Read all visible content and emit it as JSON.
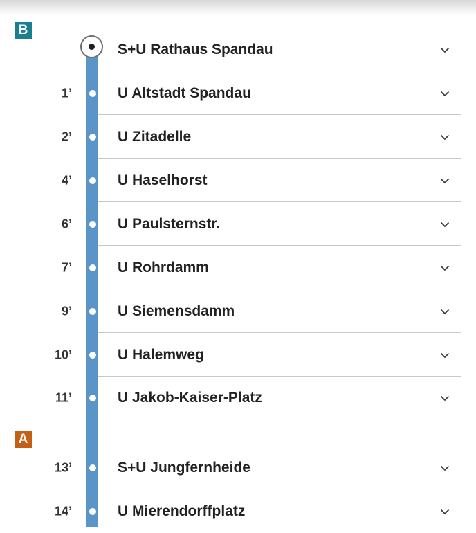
{
  "zones": {
    "b": "B",
    "a": "A"
  },
  "stops": [
    {
      "time": "",
      "name": "S+U Rathaus Spandau",
      "icon": "chevron-down-icon"
    },
    {
      "time": "1’",
      "name": "U Altstadt Spandau",
      "icon": "chevron-down-icon"
    },
    {
      "time": "2’",
      "name": "U Zitadelle",
      "icon": "chevron-down-icon"
    },
    {
      "time": "4’",
      "name": "U Haselhorst",
      "icon": "chevron-down-icon"
    },
    {
      "time": "6’",
      "name": "U Paulsternstr.",
      "icon": "chevron-down-icon"
    },
    {
      "time": "7’",
      "name": "U Rohrdamm",
      "icon": "chevron-down-icon"
    },
    {
      "time": "9’",
      "name": "U Siemensdamm",
      "icon": "chevron-down-icon"
    },
    {
      "time": "10’",
      "name": "U Halemweg",
      "icon": "chevron-down-icon"
    },
    {
      "time": "11’",
      "name": "U Jakob-Kaiser-Platz",
      "icon": "chevron-down-icon"
    },
    {
      "time": "13’",
      "name": "S+U Jungfernheide",
      "icon": "chevron-down-icon"
    },
    {
      "time": "14’",
      "name": "U Mierendorffplatz",
      "icon": "chevron-down-icon"
    }
  ],
  "colors": {
    "line": "#5b95c7",
    "zone_b": "#1a7f8e",
    "zone_a": "#c45f16",
    "divider": "#c9c9c9"
  }
}
